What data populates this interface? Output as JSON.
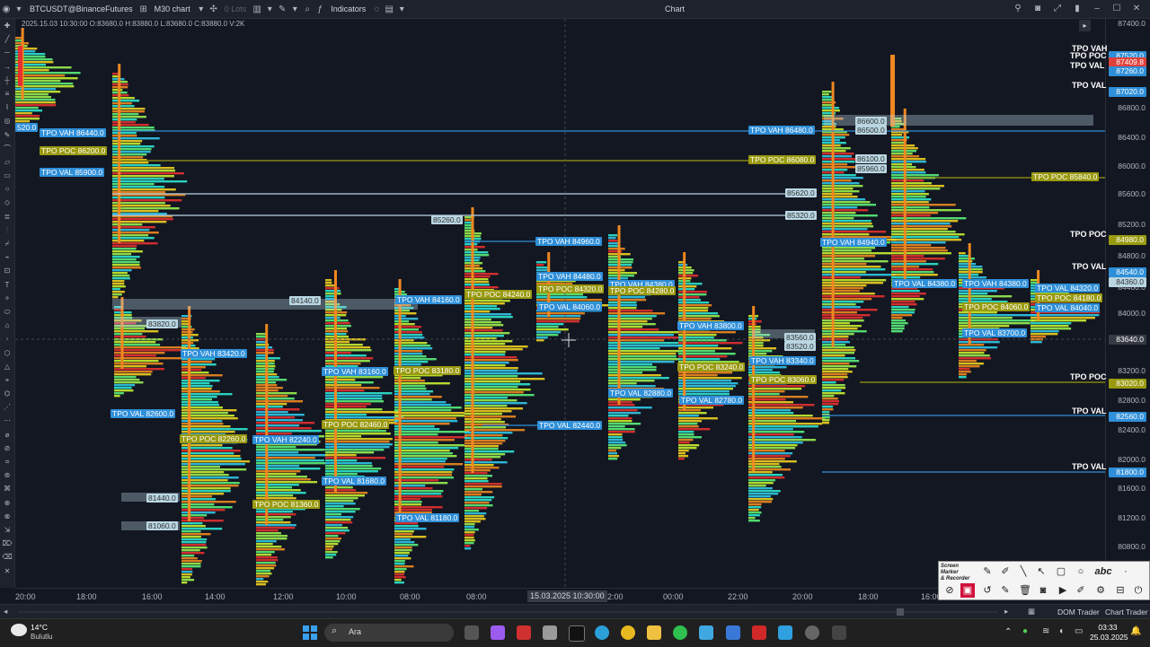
{
  "toolbar": {
    "symbol": "BTCUSDT@BinanceFutures",
    "timeframe": "M30 chart",
    "lots": "0 Lots",
    "indicators": "Indicators",
    "window_title": "Chart"
  },
  "chart": {
    "ohlc_line": "2025.15.03 10:30:00 O:83680.0 H:83880.0 L:83680.0 C:83880.0 V:2K",
    "cursor_time": "15.03.2025 10:30:00",
    "colors": {
      "background": "#131722",
      "vah_val": "#2f8fd8",
      "poc": "#9a9a10",
      "zone": "#b9d6e2",
      "current_price": "#e0403a"
    }
  },
  "price_axis": {
    "ticks": [
      "87400.0",
      "87020.0",
      "86800.0",
      "86400.0",
      "86000.0",
      "85600.0",
      "85200.0",
      "84800.0",
      "84400.0",
      "84000.0",
      "83600.0",
      "83200.0",
      "82800.0",
      "82400.0",
      "82000.0",
      "81600.0",
      "81200.0",
      "80800.0"
    ],
    "badges": [
      {
        "text": "87520.0",
        "kind": "val"
      },
      {
        "text": "87409.8",
        "kind": "price"
      },
      {
        "text": "87260.0",
        "kind": "val"
      },
      {
        "text": "87020.0",
        "kind": "val"
      },
      {
        "text": "84980.0",
        "kind": "poc"
      },
      {
        "text": "84540.0",
        "kind": "val"
      },
      {
        "text": "84360.0",
        "kind": "zone"
      },
      {
        "text": "83640.0",
        "kind": "cursor"
      },
      {
        "text": "83020.0",
        "kind": "poc"
      },
      {
        "text": "82560.0",
        "kind": "val"
      },
      {
        "text": "81800.0",
        "kind": "val"
      }
    ],
    "right_labels": [
      "TPO VAH",
      "TPO POC",
      "TPO VAL",
      "TPO VAL",
      "TPO POC",
      "TPO VAL",
      "TPO POC",
      "TPO VAL",
      "TPO VAL"
    ]
  },
  "time_axis": {
    "labels": [
      "20:00",
      "18:00",
      "16:00",
      "14:00",
      "12:00",
      "10:00",
      "08:00",
      "08:00",
      "2:00",
      "00:00",
      "22:00",
      "20:00",
      "18:00",
      "16:00"
    ]
  },
  "levels": [
    {
      "text": "520.0",
      "kind": "vah"
    },
    {
      "text": "TPO VAH 86440.0",
      "kind": "vah"
    },
    {
      "text": "TPO POC 86200.0",
      "kind": "poc"
    },
    {
      "text": "TPO VAL 85900.0",
      "kind": "val"
    },
    {
      "text": "TPO VAH 86480.0",
      "kind": "vah"
    },
    {
      "text": "TPO POC 86080.0",
      "kind": "poc"
    },
    {
      "text": "85620.0",
      "kind": "zone"
    },
    {
      "text": "85320.0",
      "kind": "zone"
    },
    {
      "text": "85260.0",
      "kind": "zone"
    },
    {
      "text": "84140.0",
      "kind": "zone"
    },
    {
      "text": "83820.0",
      "kind": "zone"
    },
    {
      "text": "TPO VAH 84960.0",
      "kind": "vah"
    },
    {
      "text": "TPO VAH 84480.0",
      "kind": "vah"
    },
    {
      "text": "TPO POC 84320.0",
      "kind": "poc"
    },
    {
      "text": "TPO POC 84240.0",
      "kind": "poc"
    },
    {
      "text": "TPO VAL 84060.0",
      "kind": "val"
    },
    {
      "text": "TPO VAH 84160.0",
      "kind": "vah"
    },
    {
      "text": "TPO VAH 84380.0",
      "kind": "vah"
    },
    {
      "text": "TPO POC 84280.0",
      "kind": "poc"
    },
    {
      "text": "TPO VAH 83420.0",
      "kind": "vah"
    },
    {
      "text": "TPO VAH 83160.0",
      "kind": "vah"
    },
    {
      "text": "TPO POC 83180.0",
      "kind": "poc"
    },
    {
      "text": "TPO VAL 82600.0",
      "kind": "val"
    },
    {
      "text": "TPO POC 82460.0",
      "kind": "poc"
    },
    {
      "text": "TPO POC 82260.0",
      "kind": "poc"
    },
    {
      "text": "TPO VAH 82240.0",
      "kind": "vah"
    },
    {
      "text": "TPO VAL 82440.0",
      "kind": "val"
    },
    {
      "text": "TPO VAL 81680.0",
      "kind": "val"
    },
    {
      "text": "TPO POC 81360.0",
      "kind": "poc"
    },
    {
      "text": "TPO VAL 81180.0",
      "kind": "val"
    },
    {
      "text": "81440.0",
      "kind": "zone"
    },
    {
      "text": "81060.0",
      "kind": "zone"
    },
    {
      "text": "TPO VAH 83800.0",
      "kind": "vah"
    },
    {
      "text": "TPO POC 83240.0",
      "kind": "poc"
    },
    {
      "text": "TPO VAL 82880.0",
      "kind": "val"
    },
    {
      "text": "TPO VAL 82780.0",
      "kind": "val"
    },
    {
      "text": "83560.0",
      "kind": "zone"
    },
    {
      "text": "83520.0",
      "kind": "zone"
    },
    {
      "text": "TPO VAH 83340.0",
      "kind": "vah"
    },
    {
      "text": "TPO POC 83060.0",
      "kind": "poc"
    },
    {
      "text": "86600.0",
      "kind": "zone"
    },
    {
      "text": "86500.0",
      "kind": "zone"
    },
    {
      "text": "86100.0",
      "kind": "zone"
    },
    {
      "text": "85960.0",
      "kind": "zone"
    },
    {
      "text": "TPO VAH 84940.0",
      "kind": "vah"
    },
    {
      "text": "TPO POC 85840.0",
      "kind": "poc"
    },
    {
      "text": "TPO VAL 84380.0",
      "kind": "val"
    },
    {
      "text": "TPO VAH 84380.0",
      "kind": "vah"
    },
    {
      "text": "TPO POC 84060.0",
      "kind": "poc"
    },
    {
      "text": "TPO VAL 83700.0",
      "kind": "val"
    },
    {
      "text": "TPO VAL 84320.0",
      "kind": "val"
    },
    {
      "text": "TPO POC 84180.0",
      "kind": "poc"
    },
    {
      "text": "TPO VAL 84040.0",
      "kind": "val"
    }
  ],
  "statusbar": {
    "dom_trader": "DOM Trader",
    "chart_trader": "Chart Trader"
  },
  "overlay": {
    "title_line1": "Screen Marker",
    "title_line2": "& Recorder",
    "abc_label": "abc"
  },
  "taskbar": {
    "weather_temp": "14°C",
    "weather_text": "Bulutlu",
    "search_label": "Ara",
    "clock_time": "03:33",
    "clock_date": "25.03.2025"
  }
}
